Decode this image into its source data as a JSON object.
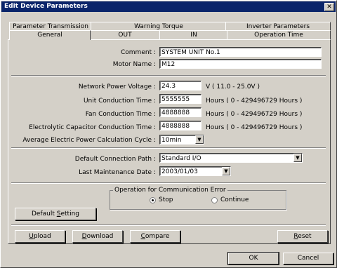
{
  "window": {
    "title": "Edit Device Parameters"
  },
  "tabs_row1": [
    {
      "label": "Parameter Transmission"
    },
    {
      "label": "Warning Torque"
    },
    {
      "label": "Inverter Parameters"
    }
  ],
  "tabs_row2": [
    {
      "label": "General"
    },
    {
      "label": "OUT"
    },
    {
      "label": "IN"
    },
    {
      "label": "Operation Time"
    }
  ],
  "general": {
    "comment_label": "Comment :",
    "comment_value": "SYSTEM UNIT No.1",
    "motor_label": "Motor Name :",
    "motor_value": "M12",
    "npv_label": "Network Power Voltage :",
    "npv_value": "24.3",
    "npv_unit": "V ( 11.0 - 25.0V )",
    "uct_label": "Unit Conduction Time :",
    "uct_value": "5555555",
    "uct_unit": "Hours ( 0 - 429496729 Hours )",
    "fct_label": "Fan Conduction Time :",
    "fct_value": "4888888",
    "fct_unit": "Hours ( 0 - 429496729 Hours )",
    "ecct_label": "Electrolytic Capacitor Conduction Time :",
    "ecct_value": "4888888",
    "ecct_unit": "Hours ( 0 - 429496729 Hours )",
    "aep_label": "Average Electric Power Calculation Cycle :",
    "aep_value": "10min",
    "dcp_label": "Default Connection Path :",
    "dcp_value": "Standard I/O",
    "lmd_label": "Last Maintenance Date :",
    "lmd_value": "2003/01/03",
    "comm_error_title": "Operation for Communication Error",
    "radio_stop": "Stop",
    "radio_continue": "Continue",
    "selected": "Stop"
  },
  "buttons": {
    "default_setting_pre": "Default ",
    "default_setting_u": "S",
    "default_setting_post": "etting",
    "upload_u": "U",
    "upload_post": "pload",
    "download_u": "D",
    "download_post": "ownload",
    "compare_u": "C",
    "compare_post": "ompare",
    "reset_u": "R",
    "reset_post": "eset",
    "ok": "OK",
    "cancel": "Cancel"
  },
  "icons": {
    "close": "close-icon",
    "dropdown": "dropdown-arrow-icon"
  }
}
